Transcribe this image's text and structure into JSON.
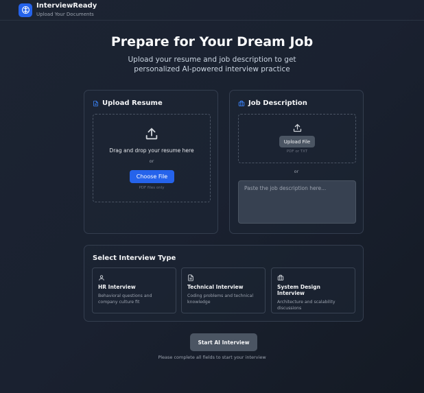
{
  "header": {
    "app_name": "InterviewReady",
    "subtitle": "Upload Your Documents",
    "logo_icon": "brain-icon"
  },
  "hero": {
    "title": "Prepare for Your Dream Job",
    "subtitle": "Upload your resume and job description to get personalized AI-powered interview practice"
  },
  "resume": {
    "title": "Upload Resume",
    "icon": "document-icon",
    "drop_text": "Drag and drop your resume here",
    "or": "or",
    "button": "Choose File",
    "hint": "PDF files only"
  },
  "job": {
    "title": "Job Description",
    "icon": "briefcase-icon",
    "upload_button": "Upload File",
    "hint": "PDF or TXT",
    "or": "or",
    "textarea_placeholder": "Paste the job description here..."
  },
  "interview_type": {
    "title": "Select Interview Type",
    "options": [
      {
        "icon": "user-icon",
        "title": "HR Interview",
        "desc": "Behavioral questions and company culture fit"
      },
      {
        "icon": "file-code-icon",
        "title": "Technical Interview",
        "desc": "Coding problems and technical knowledge"
      },
      {
        "icon": "briefcase-icon",
        "title": "System Design Interview",
        "desc": "Architecture and scalability discussions"
      }
    ]
  },
  "actions": {
    "start_button": "Start AI Interview",
    "hint": "Please complete all fields to start your interview"
  },
  "colors": {
    "accent": "#2563eb",
    "background": "#1a2130",
    "card_border": "#343e4f",
    "disabled_button": "#4b5563"
  }
}
